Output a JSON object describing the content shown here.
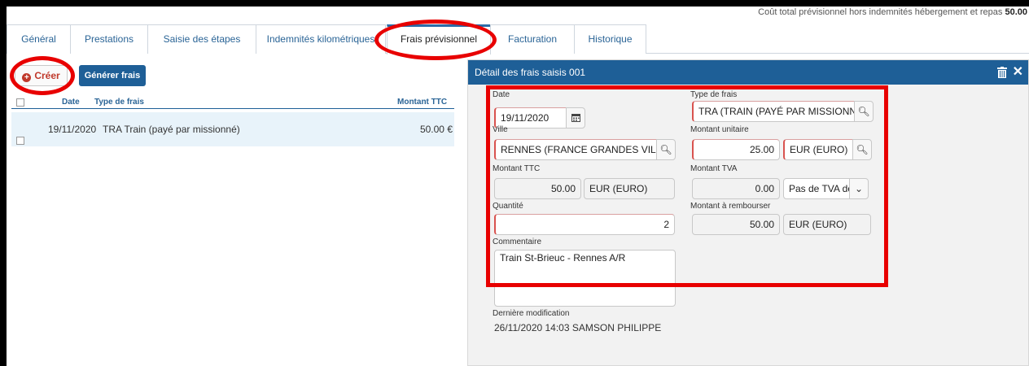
{
  "header": {
    "info_text": "Coût total prévisionnel hors indemnités hébergement et repas",
    "info_value": "50.00"
  },
  "tabs": [
    {
      "label": "Général"
    },
    {
      "label": "Prestations"
    },
    {
      "label": "Saisie des étapes"
    },
    {
      "label": "Indemnités kilométriques"
    },
    {
      "label": "Frais prévisionnel"
    },
    {
      "label": "Facturation"
    },
    {
      "label": "Historique"
    }
  ],
  "toolbar": {
    "create_label": "Créer",
    "generate_label": "Générer frais"
  },
  "list": {
    "columns": [
      "Date",
      "Type de frais",
      "Montant TTC"
    ],
    "rows": [
      {
        "date": "19/11/2020",
        "type": "TRA Train (payé par missionné)",
        "amount": "50.00 €"
      }
    ]
  },
  "detail": {
    "title": "Détail des frais saisis 001",
    "fields": {
      "date": {
        "label": "Date",
        "value": "19/11/2020"
      },
      "type_frais": {
        "label": "Type de frais",
        "value": "TRA (TRAIN (PAYÉ PAR MISSIONNÉ))"
      },
      "ville": {
        "label": "Ville",
        "value": "RENNES (FRANCE GRANDES VILLES"
      },
      "montant_unitaire": {
        "label": "Montant unitaire",
        "value": "25.00",
        "currency": "EUR (EURO)"
      },
      "montant_ttc": {
        "label": "Montant TTC",
        "value": "50.00",
        "currency": "EUR (EURO)"
      },
      "montant_tva": {
        "label": "Montant TVA",
        "value": "0.00",
        "select": "Pas de TVA de"
      },
      "quantite": {
        "label": "Quantité",
        "value": "2"
      },
      "montant_rembourser": {
        "label": "Montant à rembourser",
        "value": "50.00",
        "currency": "EUR (EURO)"
      },
      "commentaire": {
        "label": "Commentaire",
        "value": "Train St-Brieuc - Rennes A/R"
      }
    },
    "last_modified": {
      "label": "Dernière modification",
      "value": "26/11/2020 14:03 SAMSON PHILIPPE"
    }
  },
  "colors": {
    "accent": "#1e5f97",
    "annotation": "#e80000",
    "required": "#d9534f"
  }
}
